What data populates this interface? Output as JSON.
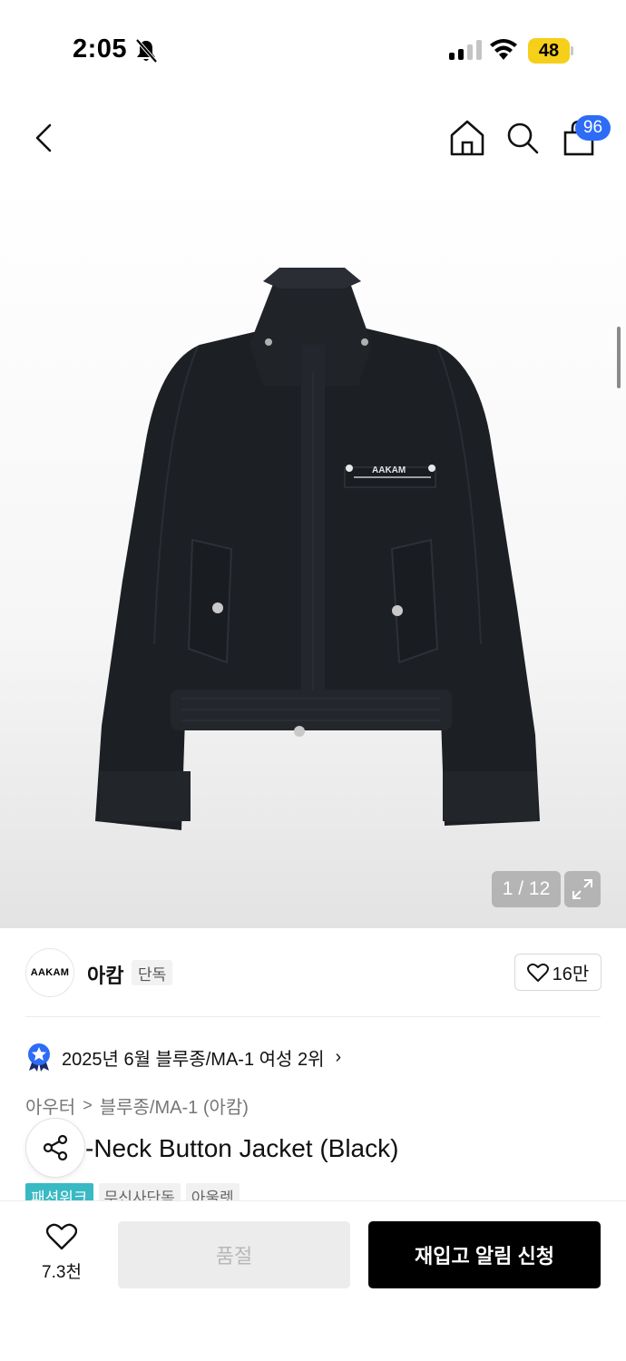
{
  "status_bar": {
    "time": "2:05",
    "battery": "48",
    "icons": [
      "bell-off-icon",
      "signal-icon",
      "wifi-icon",
      "battery-icon"
    ]
  },
  "nav": {
    "icons": [
      "back-icon",
      "home-icon",
      "search-icon",
      "cart-icon"
    ],
    "cart_count": "96"
  },
  "gallery": {
    "brand_print": "AAKAM",
    "page_indicator": "1 / 12",
    "current_page": 1,
    "total_pages": 12
  },
  "brand": {
    "logo_text": "AAKAM",
    "name": "아캄",
    "badge": "단독",
    "likes": "16만"
  },
  "ranking": {
    "text": "2025년 6월 블루종/MA-1 여성 2위",
    "chevron": "›"
  },
  "breadcrumb": {
    "items": [
      "아우터",
      "블루종/MA-1 (아캄)"
    ],
    "separator": ">"
  },
  "product": {
    "title": "-Neck Button Jacket (Black)"
  },
  "tags": [
    "패션위크",
    "무신사단독",
    "아울렛"
  ],
  "bottom": {
    "wish_count": "7.3천",
    "soldout_label": "품절",
    "restock_label": "재입고 알림 신청"
  },
  "colors": {
    "accent_blue": "#2d6cf6",
    "tag_teal": "#39b9c4",
    "battery_yellow": "#f5cf1a",
    "primary_button": "#000000"
  }
}
